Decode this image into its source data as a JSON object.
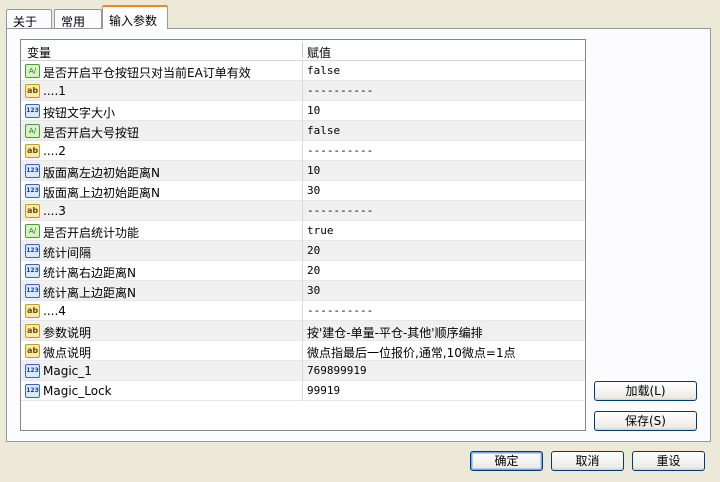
{
  "tabs": [
    {
      "label": "关于"
    },
    {
      "label": "常用"
    },
    {
      "label": "输入参数"
    }
  ],
  "grid": {
    "col_variable": "变量",
    "col_value": "赋值"
  },
  "params": [
    {
      "type": "bool",
      "name": "是否开启平仓按钮只对当前EA订单有效",
      "value": "false"
    },
    {
      "type": "string",
      "name": "....1",
      "value": "----------"
    },
    {
      "type": "int",
      "name": "按钮文字大小",
      "value": "10"
    },
    {
      "type": "bool",
      "name": "是否开启大号按钮",
      "value": "false"
    },
    {
      "type": "string",
      "name": "....2",
      "value": "----------"
    },
    {
      "type": "int",
      "name": "版面离左边初始距离N",
      "value": "10"
    },
    {
      "type": "int",
      "name": "版面离上边初始距离N",
      "value": "30"
    },
    {
      "type": "string",
      "name": "....3",
      "value": "----------"
    },
    {
      "type": "bool",
      "name": "是否开启统计功能",
      "value": "true"
    },
    {
      "type": "int",
      "name": "统计间隔",
      "value": "20"
    },
    {
      "type": "int",
      "name": "统计离右边距离N",
      "value": "20"
    },
    {
      "type": "int",
      "name": "统计离上边距离N",
      "value": "30"
    },
    {
      "type": "string",
      "name": "....4",
      "value": "----------"
    },
    {
      "type": "string",
      "name": "参数说明",
      "value": "按'建仓-单量-平仓-其他'顺序编排"
    },
    {
      "type": "string",
      "name": "微点说明",
      "value": "微点指最后一位报价,通常,10微点=1点"
    },
    {
      "type": "int",
      "name": "Magic_1",
      "value": "769899919"
    },
    {
      "type": "int",
      "name": "Magic_Lock",
      "value": "99919"
    }
  ],
  "icons": {
    "bool": "A/",
    "string": "ab",
    "int": "123"
  },
  "side_buttons": {
    "load": "加载(L)",
    "save": "保存(S)"
  },
  "footer_buttons": {
    "ok": "确定",
    "cancel": "取消",
    "reset": "重设"
  }
}
